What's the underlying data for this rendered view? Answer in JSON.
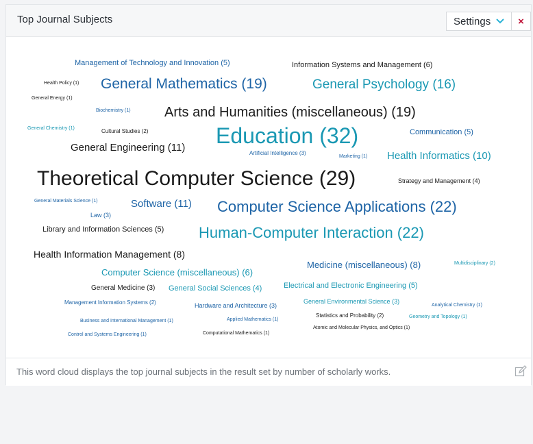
{
  "panel": {
    "title": "Top Journal Subjects",
    "settings_label": "Settings",
    "close_label": "×",
    "footer_text": "This word cloud displays the top journal subjects in the result set by number of scholarly works."
  },
  "colors": {
    "teal": "#1a98b3",
    "blue": "#1e64a6",
    "black": "#1b1b1b",
    "close_red": "#c0163a"
  },
  "words": [
    {
      "text": "Management of Technology and Innovation (5)"
    },
    {
      "text": "Information Systems and Management (6)"
    },
    {
      "text": "Health Policy (1)"
    },
    {
      "text": "General Mathematics (19)"
    },
    {
      "text": "General Psychology (16)"
    },
    {
      "text": "General Energy (1)"
    },
    {
      "text": "Biochemistry (1)"
    },
    {
      "text": "Arts and Humanities (miscellaneous) (19)"
    },
    {
      "text": "General Chemistry (1)"
    },
    {
      "text": "Cultural Studies (2)"
    },
    {
      "text": "Education (32)"
    },
    {
      "text": "Communication (5)"
    },
    {
      "text": "General Engineering (11)"
    },
    {
      "text": "Artificial Intelligence (3)"
    },
    {
      "text": "Marketing (1)"
    },
    {
      "text": "Health Informatics (10)"
    },
    {
      "text": "Theoretical Computer Science (29)"
    },
    {
      "text": "Strategy and Management (4)"
    },
    {
      "text": "General Materials Science (1)"
    },
    {
      "text": "Software (11)"
    },
    {
      "text": "Computer Science Applications (22)"
    },
    {
      "text": "Law (3)"
    },
    {
      "text": "Library and Information Sciences (5)"
    },
    {
      "text": "Human-Computer Interaction (22)"
    },
    {
      "text": "Health Information Management (8)"
    },
    {
      "text": "Computer Science (miscellaneous) (6)"
    },
    {
      "text": "Medicine (miscellaneous) (8)"
    },
    {
      "text": "Multidisciplinary (2)"
    },
    {
      "text": "General Medicine (3)"
    },
    {
      "text": "General Social Sciences (4)"
    },
    {
      "text": "Electrical and Electronic Engineering (5)"
    },
    {
      "text": "Management Information Systems (2)"
    },
    {
      "text": "Hardware and Architecture (3)"
    },
    {
      "text": "General Environmental Science (3)"
    },
    {
      "text": "Analytical Chemistry (1)"
    },
    {
      "text": "Business and International Management (1)"
    },
    {
      "text": "Applied Mathematics (1)"
    },
    {
      "text": "Statistics and Probability (2)"
    },
    {
      "text": "Geometry and Topology (1)"
    },
    {
      "text": "Atomic and Molecular Physics, and Optics (1)"
    },
    {
      "text": "Control and Systems Engineering (1)"
    },
    {
      "text": "Computational Mathematics (1)"
    }
  ]
}
